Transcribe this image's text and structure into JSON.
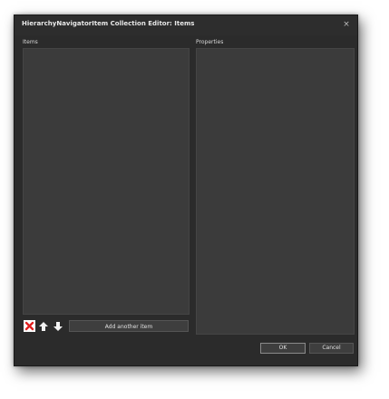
{
  "dialog": {
    "title": "HierarchyNavigatorItem Collection Editor: Items",
    "close_glyph": "×"
  },
  "items_section": {
    "label": "Items"
  },
  "properties_section": {
    "label": "Properties"
  },
  "toolbar": {
    "delete_icon": "delete-icon",
    "move_up_icon": "arrow-up-icon",
    "move_down_icon": "arrow-down-icon",
    "add_label": "Add another item"
  },
  "buttons": {
    "ok_label": "OK",
    "cancel_label": "Cancel"
  },
  "colors": {
    "background": "#2b2b2b",
    "panel": "#3b3b3b",
    "delete_red": "#e02020"
  }
}
